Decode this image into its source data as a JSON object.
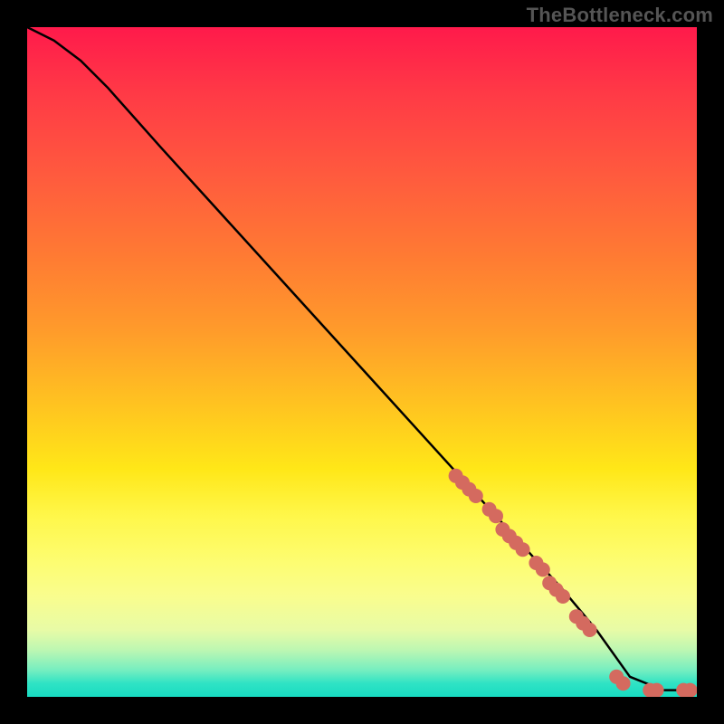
{
  "watermark": "TheBottleneck.com",
  "chart_data": {
    "type": "line",
    "title": "",
    "xlabel": "",
    "ylabel": "",
    "xlim": [
      0,
      100
    ],
    "ylim": [
      0,
      100
    ],
    "series": [
      {
        "name": "curve",
        "x": [
          0,
          4,
          8,
          12,
          20,
          30,
          40,
          50,
          60,
          70,
          80,
          85,
          90,
          95,
          100
        ],
        "y": [
          100,
          98,
          95,
          91,
          82,
          71,
          60,
          49,
          38,
          27,
          16,
          10,
          3,
          1,
          1
        ]
      }
    ],
    "markers": {
      "name": "dashed-segment",
      "color": "#d46a5f",
      "x": [
        64,
        65,
        66,
        67,
        69,
        70,
        71,
        72,
        73,
        74,
        76,
        77,
        78,
        79,
        80,
        82,
        83,
        84,
        88,
        89,
        93,
        94,
        98,
        99
      ],
      "y": [
        33,
        32,
        31,
        30,
        28,
        27,
        25,
        24,
        23,
        22,
        20,
        19,
        17,
        16,
        15,
        12,
        11,
        10,
        3,
        2,
        1,
        1,
        1,
        1
      ]
    },
    "gradient_stops": [
      {
        "pos": 0.0,
        "color": "#ff1a4b"
      },
      {
        "pos": 0.22,
        "color": "#ff5a3e"
      },
      {
        "pos": 0.45,
        "color": "#ff9a2b"
      },
      {
        "pos": 0.66,
        "color": "#ffe718"
      },
      {
        "pos": 0.85,
        "color": "#f9fd8e"
      },
      {
        "pos": 0.96,
        "color": "#76eec0"
      },
      {
        "pos": 1.0,
        "color": "#18dbc2"
      }
    ]
  }
}
